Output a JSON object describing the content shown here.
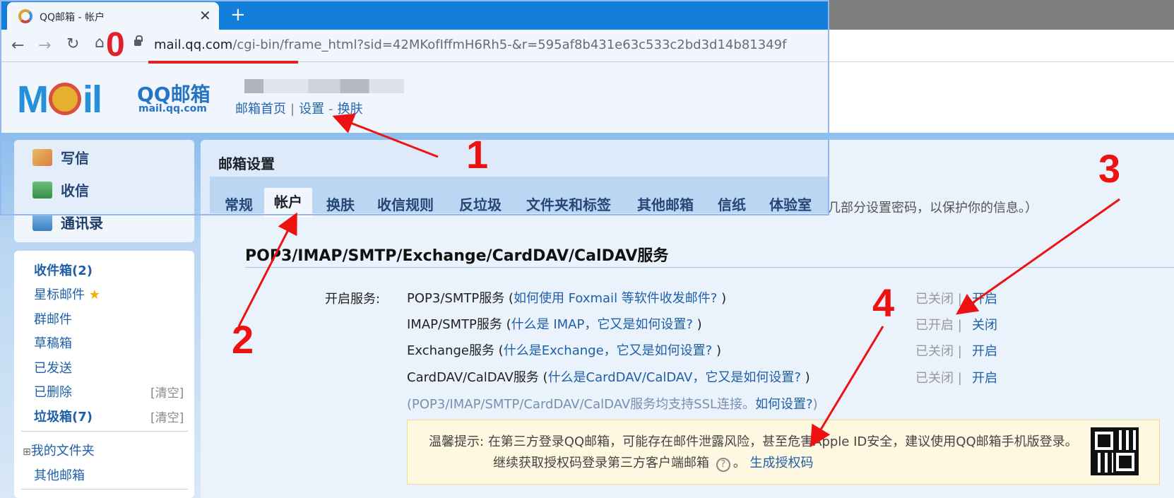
{
  "browser": {
    "tab_title": "QQ邮箱 - 帐户",
    "tab_close": "✕",
    "new_tab": "+",
    "url_host": "mail.qq.com",
    "url_path": "/cgi-bin/frame_html?sid=42MKofIffmH6Rh5-&r=595af8b431e63c533c2bd3d14b81349f",
    "nav": {
      "back": "←",
      "forward": "→",
      "reload": "↻",
      "home": "⌂"
    }
  },
  "header": {
    "logo_text": "M",
    "logo_text2": "il",
    "logo_cn": "QQ邮箱",
    "logo_domain": "mail.qq.com",
    "links": {
      "home": "邮箱首页",
      "settings": "设置",
      "dash": "-",
      "skin": "换肤"
    }
  },
  "sidebar": {
    "actions": [
      {
        "label": "写信",
        "icon": "compose-icon"
      },
      {
        "label": "收信",
        "icon": "inbox-download-icon"
      },
      {
        "label": "通讯录",
        "icon": "contacts-icon"
      }
    ],
    "folders": {
      "inbox": "收件箱(2)",
      "starred": "星标邮件",
      "star_glyph": "★",
      "group": "群邮件",
      "drafts": "草稿箱",
      "sent": "已发送",
      "deleted": "已删除",
      "junk": "垃圾箱(7)",
      "clear": "[清空]",
      "my_folders": "我的文件夹",
      "expand_glyph": "⊞",
      "other": "其他邮箱"
    }
  },
  "settings": {
    "title": "邮箱设置",
    "tabs": [
      "常规",
      "帐户",
      "换肤",
      "收信规则",
      "反垃圾",
      "文件夹和标签",
      "其他邮箱",
      "信纸",
      "体验室"
    ],
    "active_tab": "帐户",
    "notice_tail": "几部分设置密码，以保护你的信息。）",
    "section_title": "POP3/IMAP/SMTP/Exchange/CardDAV/CalDAV服务",
    "open_service_label": "开启服务:",
    "services": [
      {
        "name": "POP3/SMTP服务 (",
        "help": "如何使用 Foxmail 等软件收发邮件?",
        "close": " )",
        "status": "已关闭",
        "sep": "|",
        "action": "开启"
      },
      {
        "name": "IMAP/SMTP服务 (",
        "help": "什么是 IMAP，它又是如何设置?",
        "close": " )",
        "status": "已开启",
        "sep": "|",
        "action": "关闭"
      },
      {
        "name": "Exchange服务 (",
        "help": "什么是Exchange，它又是如何设置?",
        "close": " )",
        "status": "已关闭",
        "sep": "|",
        "action": "开启"
      },
      {
        "name": "CardDAV/CalDAV服务 (",
        "help": "什么是CardDAV/CalDAV，它又是如何设置?",
        "close": " )",
        "status": "已关闭",
        "sep": "|",
        "action": "开启"
      }
    ],
    "ssl_note": "(POP3/IMAP/SMTP/CardDAV/CalDAV服务均支持SSL连接。",
    "ssl_link": "如何设置?",
    "ssl_close": ")",
    "tip": {
      "label": "温馨提示:",
      "line1": "在第三方登录QQ邮箱，可能存在邮件泄露风险，甚至危害Apple ID安全，建议使用QQ邮箱手机版登录。",
      "line2": "继续获取授权码登录第三方客户端邮箱",
      "help_glyph": "?",
      "period": "。",
      "link": "生成授权码"
    }
  },
  "annotations": [
    "0",
    "1",
    "2",
    "3",
    "4"
  ],
  "colors": {
    "annotation": "#ee1111",
    "link": "#1e5fa8",
    "tabbar": "#0a7bd9"
  }
}
